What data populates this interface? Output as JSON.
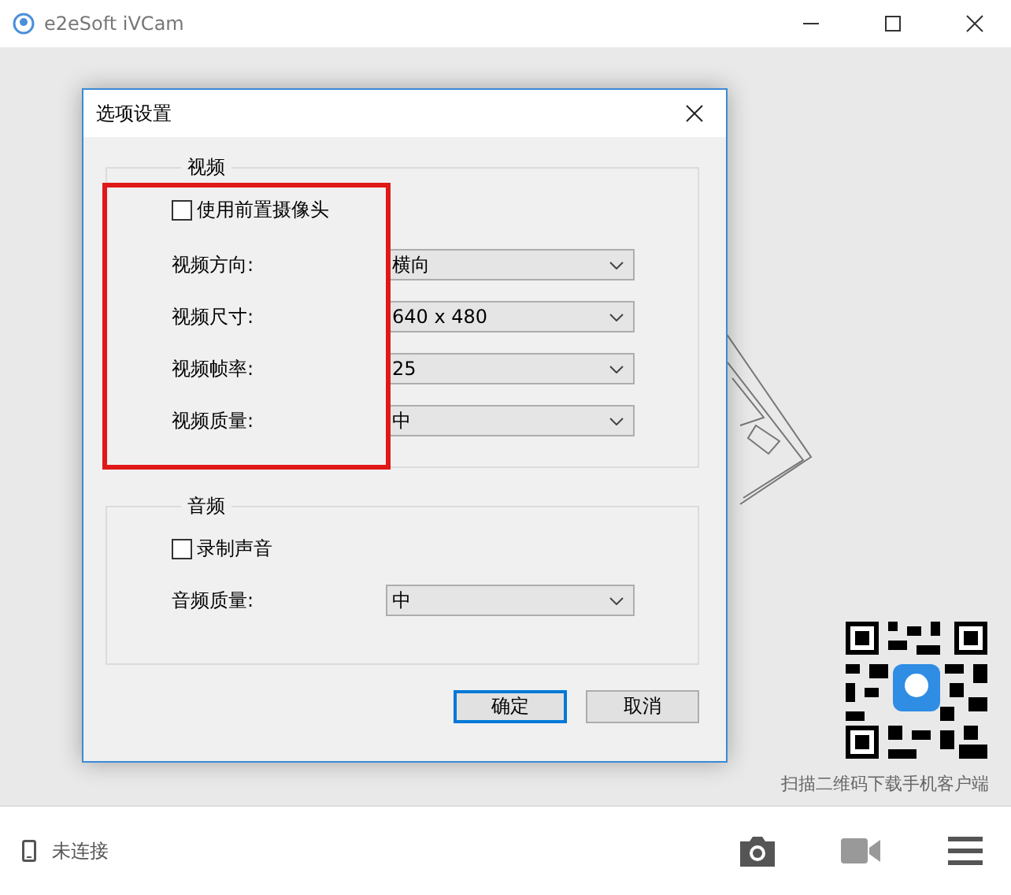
{
  "window": {
    "title": "e2eSoft iVCam"
  },
  "dialog": {
    "title": "选项设置",
    "groups": [
      {
        "title": "视频",
        "checkbox": {
          "label": "使用前置摄像头",
          "checked": false
        },
        "fields": [
          {
            "label": "视频方向:",
            "value": "横向"
          },
          {
            "label": "视频尺寸:",
            "value": "640 x 480"
          },
          {
            "label": "视频帧率:",
            "value": "25"
          },
          {
            "label": "视频质量:",
            "value": "中"
          }
        ]
      },
      {
        "title": "音频",
        "checkbox": {
          "label": "录制声音",
          "checked": false
        },
        "fields": [
          {
            "label": "音频质量:",
            "value": "中"
          }
        ]
      }
    ],
    "buttons": [
      {
        "label": "确定",
        "default": true
      },
      {
        "label": "取消",
        "default": false
      }
    ]
  },
  "qr_caption": "扫描二维码下载手机客户端",
  "status_bar": {
    "connection": "未连接"
  }
}
